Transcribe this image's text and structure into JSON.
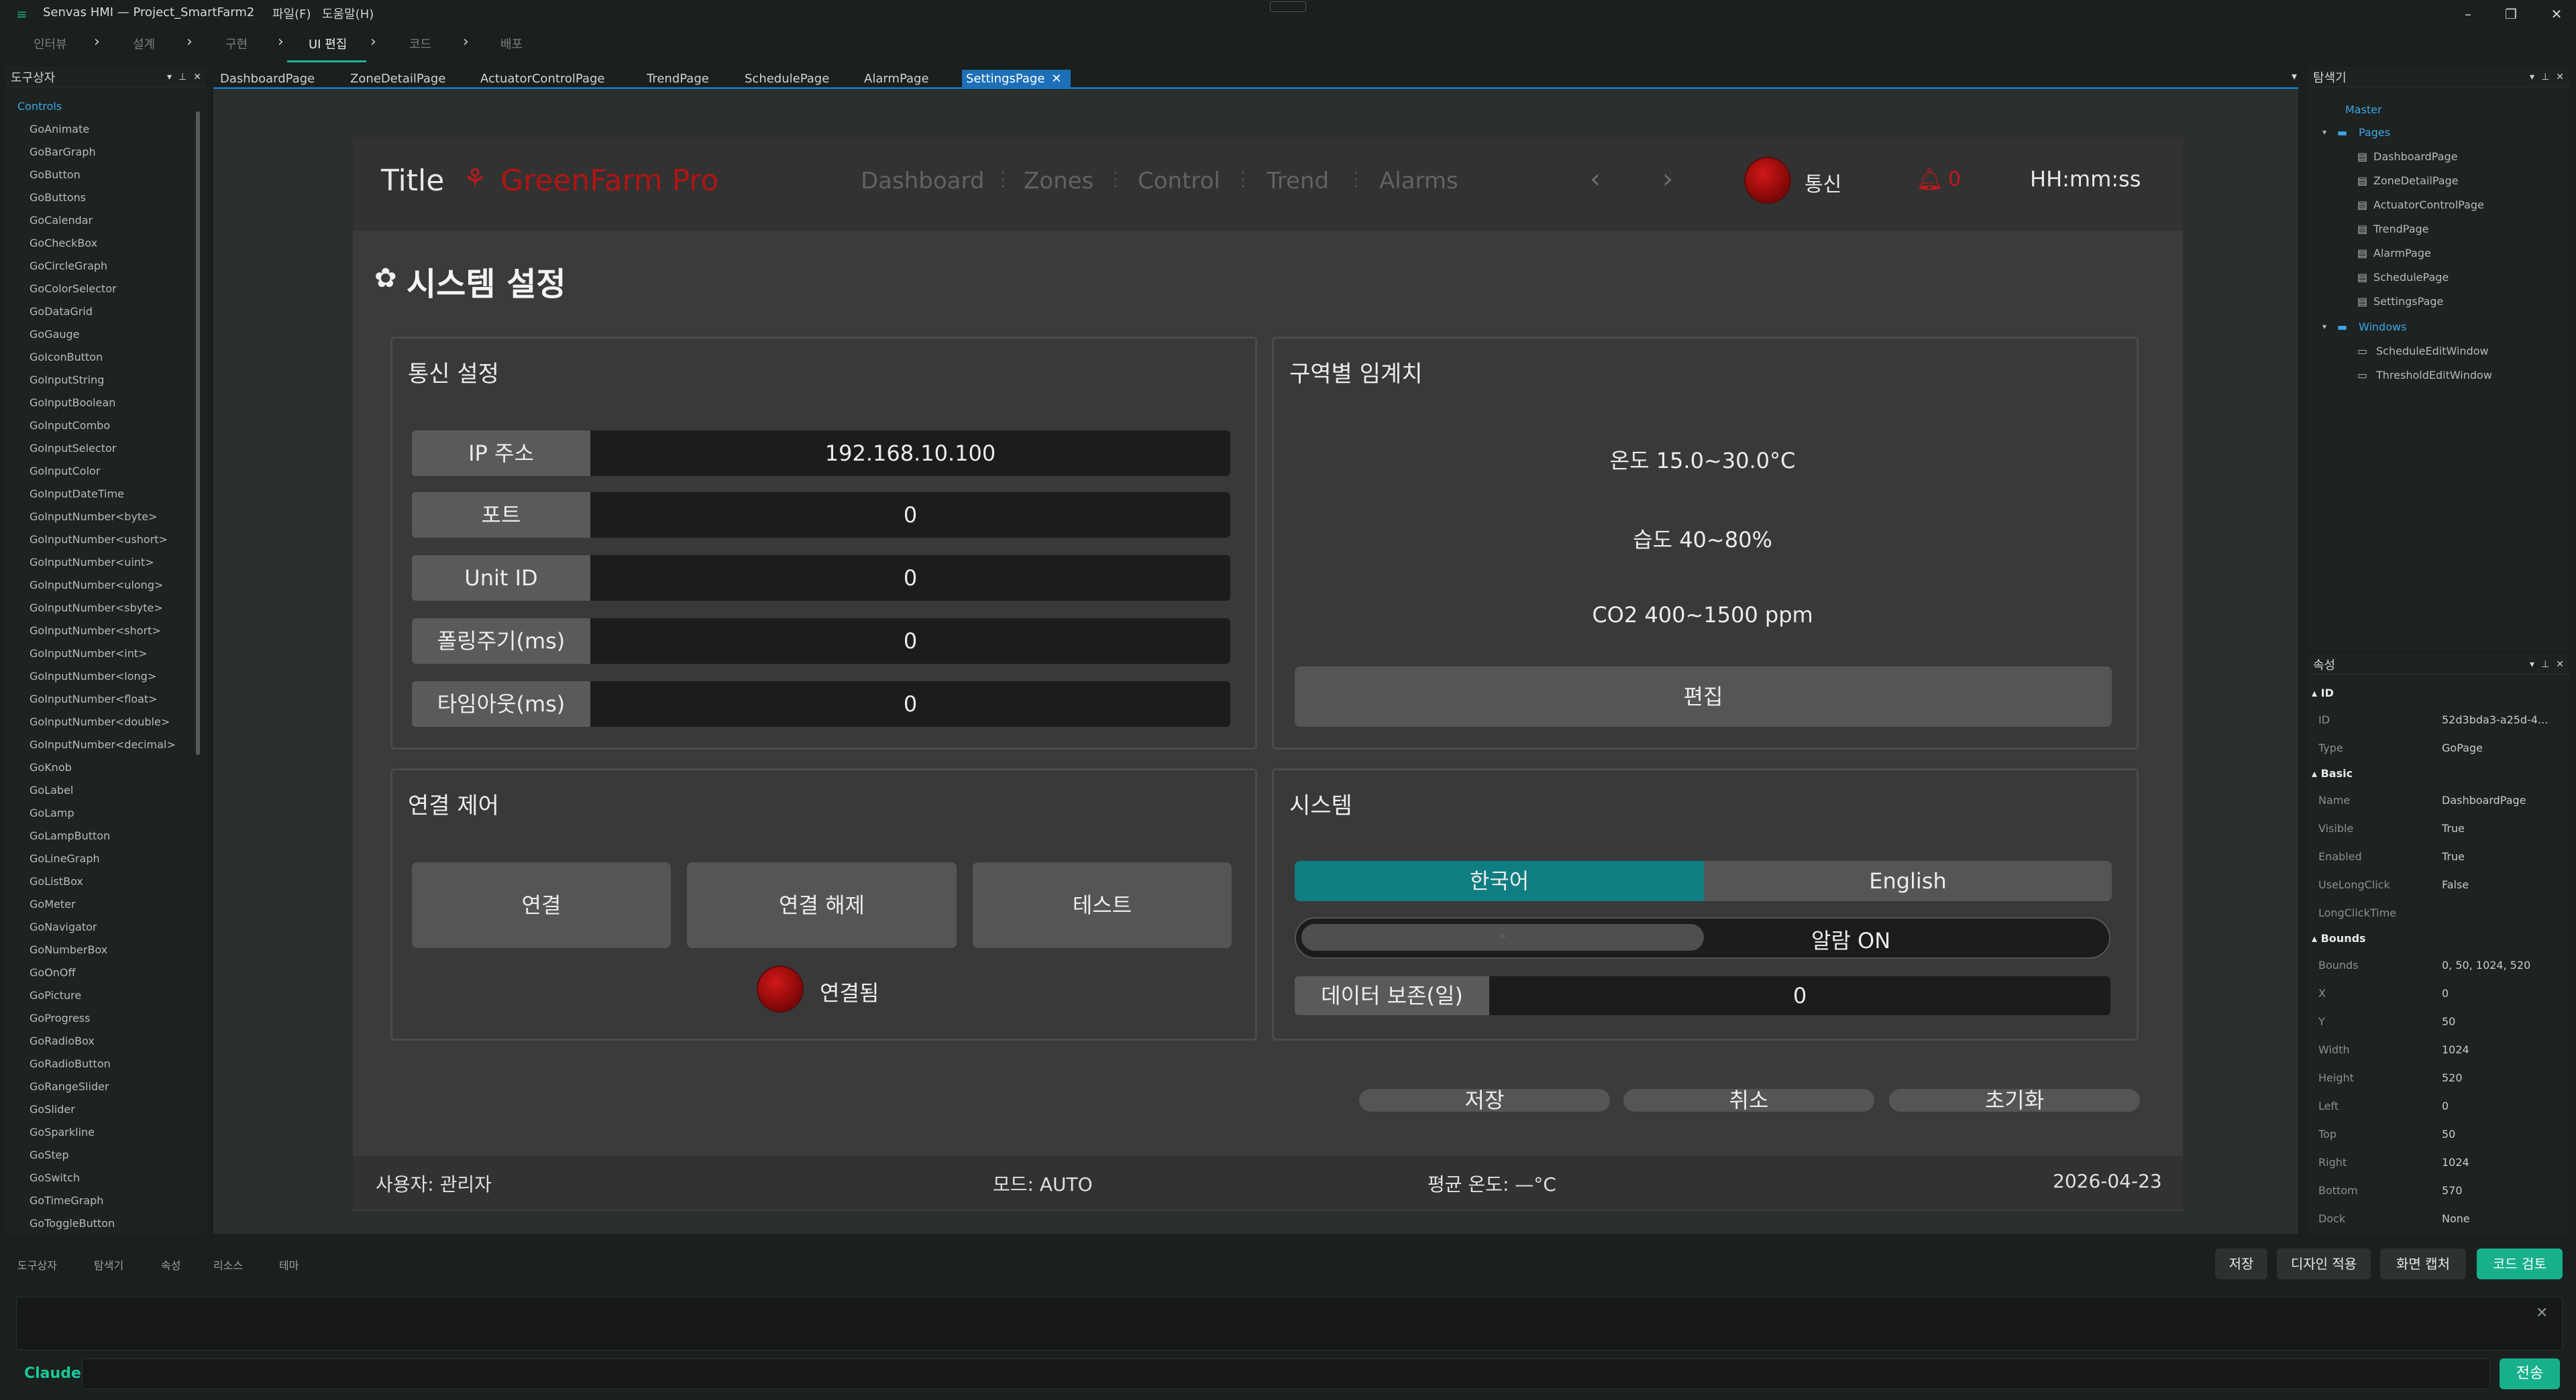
{
  "app": {
    "title": "Senvas HMI — Project_SmartFarm2",
    "menu": [
      "파일(F)",
      "도움말(H)"
    ]
  },
  "workflow": {
    "steps": [
      "인터뷰",
      "설계",
      "구현",
      "UI 편집",
      "코드",
      "배포"
    ],
    "active": "UI 편집"
  },
  "toolbox": {
    "title": "도구상자",
    "group": "Controls",
    "items": [
      "GoAnimate",
      "GoBarGraph",
      "GoButton",
      "GoButtons",
      "GoCalendar",
      "GoCheckBox",
      "GoCircleGraph",
      "GoColorSelector",
      "GoDataGrid",
      "GoGauge",
      "GoIconButton",
      "GoInputString",
      "GoInputBoolean",
      "GoInputCombo",
      "GoInputSelector",
      "GoInputColor",
      "GoInputDateTime",
      "GoInputNumber<byte>",
      "GoInputNumber<ushort>",
      "GoInputNumber<uint>",
      "GoInputNumber<ulong>",
      "GoInputNumber<sbyte>",
      "GoInputNumber<short>",
      "GoInputNumber<int>",
      "GoInputNumber<long>",
      "GoInputNumber<float>",
      "GoInputNumber<double>",
      "GoInputNumber<decimal>",
      "GoKnob",
      "GoLabel",
      "GoLamp",
      "GoLampButton",
      "GoLineGraph",
      "GoListBox",
      "GoMeter",
      "GoNavigator",
      "GoNumberBox",
      "GoOnOff",
      "GoPicture",
      "GoProgress",
      "GoRadioBox",
      "GoRadioButton",
      "GoRangeSlider",
      "GoSlider",
      "GoSparkline",
      "GoStep",
      "GoSwitch",
      "GoTimeGraph",
      "GoToggleButton"
    ]
  },
  "tabs": [
    "DashboardPage",
    "ZoneDetailPage",
    "ActuatorControlPage",
    "TrendPage",
    "SchedulePage",
    "AlarmPage",
    "SettingsPage"
  ],
  "active_tab": "SettingsPage",
  "hmi": {
    "header_title": "Title",
    "brand": "GreenFarm Pro",
    "nav": [
      "Dashboard",
      "Zones",
      "Control",
      "Trend",
      "Alarms"
    ],
    "comm_label": "통신",
    "alarm_count": "0",
    "clock": "HH:mm:ss",
    "page_title": "시스템 설정",
    "comm_card": {
      "title": "통신 설정",
      "fields": [
        {
          "label": "IP 주소",
          "value": "192.168.10.100"
        },
        {
          "label": "포트",
          "value": "0"
        },
        {
          "label": "Unit ID",
          "value": "0"
        },
        {
          "label": "폴링주기(ms)",
          "value": "0"
        },
        {
          "label": "타임아웃(ms)",
          "value": "0"
        }
      ]
    },
    "threshold_card": {
      "title": "구역별 임계치",
      "rows": [
        "온도 15.0~30.0°C",
        "습도 40~80%",
        "CO2 400~1500 ppm"
      ],
      "edit": "편집"
    },
    "conn_card": {
      "title": "연결 제어",
      "buttons": [
        "연결",
        "연결 해제",
        "테스트"
      ],
      "status": "연결됨"
    },
    "system_card": {
      "title": "시스템",
      "lang": [
        "한국어",
        "English"
      ],
      "alarm_switch": "알람 ON",
      "retention_label": "데이터 보존(일)",
      "retention_value": "0"
    },
    "actions": [
      "저장",
      "취소",
      "초기화"
    ],
    "footer": [
      "사용자: 관리자",
      "모드: AUTO",
      "평균 온도: —°C",
      "2026-04-23"
    ]
  },
  "explorer": {
    "title": "탐색기",
    "root": "Master",
    "pages_folder": "Pages",
    "pages": [
      "DashboardPage",
      "ZoneDetailPage",
      "ActuatorControlPage",
      "TrendPage",
      "AlarmPage",
      "SchedulePage",
      "SettingsPage"
    ],
    "windows_folder": "Windows",
    "windows": [
      "ScheduleEditWindow",
      "ThresholdEditWindow"
    ]
  },
  "properties": {
    "title": "속성",
    "sections": {
      "id": "ID",
      "basic": "Basic",
      "bounds": "Bounds"
    },
    "id_rows": [
      {
        "k": "ID",
        "v": "52d3bda3-a25d-4..."
      },
      {
        "k": "Type",
        "v": "GoPage"
      }
    ],
    "basic_rows": [
      {
        "k": "Name",
        "v": "DashboardPage"
      },
      {
        "k": "Visible",
        "v": "True"
      },
      {
        "k": "Enabled",
        "v": "True"
      },
      {
        "k": "UseLongClick",
        "v": "False"
      },
      {
        "k": "LongClickTime",
        "v": ""
      }
    ],
    "bounds_rows": [
      {
        "k": "Bounds",
        "v": "0, 50, 1024, 520"
      },
      {
        "k": "X",
        "v": "0"
      },
      {
        "k": "Y",
        "v": "50"
      },
      {
        "k": "Width",
        "v": "1024"
      },
      {
        "k": "Height",
        "v": "520"
      },
      {
        "k": "Left",
        "v": "0"
      },
      {
        "k": "Top",
        "v": "50"
      },
      {
        "k": "Right",
        "v": "1024"
      },
      {
        "k": "Bottom",
        "v": "570"
      },
      {
        "k": "Dock",
        "v": "None"
      }
    ]
  },
  "bottom_tabs": [
    "도구상자",
    "탐색기",
    "속성",
    "리소스",
    "테마"
  ],
  "bottom_actions": [
    "저장",
    "디자인 적용",
    "화면 캡처",
    "코드 검토"
  ],
  "chat": {
    "label": "Claude",
    "send": "전송"
  },
  "colors": {
    "accent": "#17b08a",
    "brand_red": "#b01414",
    "tab_blue": "#1d6fb8",
    "lang_active": "#0f7e82"
  }
}
